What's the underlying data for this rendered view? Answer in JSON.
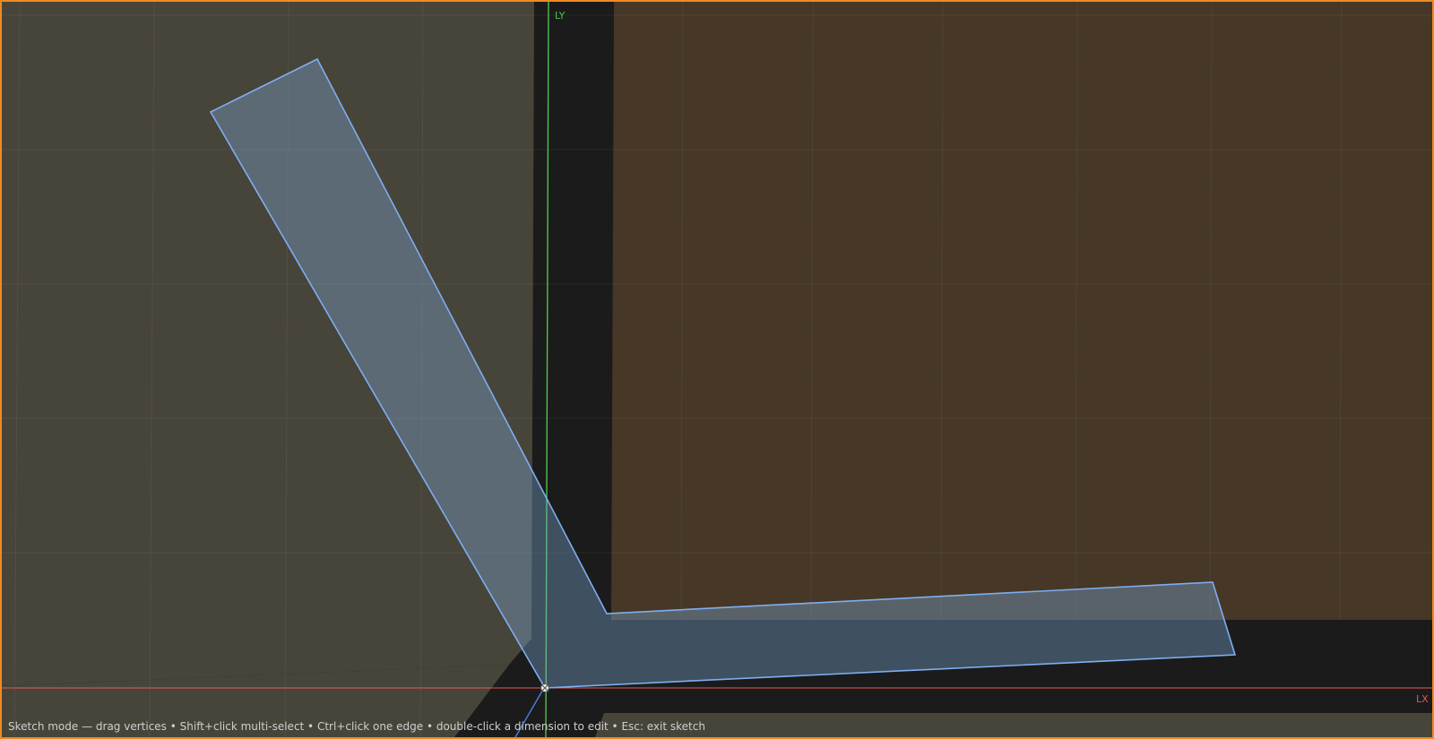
{
  "viewport": {
    "border_color": "#f08a24",
    "background_color": "#1b1b1b"
  },
  "faces": {
    "left_wall_color": "#47443a",
    "right_wall_color": "#463727",
    "floor_color": "#47443a",
    "divider_color": "#1b1b1b"
  },
  "axes": {
    "x_label": "LX",
    "y_label": "LY",
    "x_color": "#e45a50",
    "y_color": "#4fc24f",
    "z_color": "#4c7fe0"
  },
  "sketch": {
    "outline_color": "#7eaef2",
    "fill_color": "#7ba7d6",
    "origin_vertex_icon": "vertex-handle-icon"
  },
  "status": {
    "hint": "Sketch mode — drag vertices • Shift+click multi-select • Ctrl+click one edge • double-click a dimension to edit • Esc: exit sketch"
  }
}
